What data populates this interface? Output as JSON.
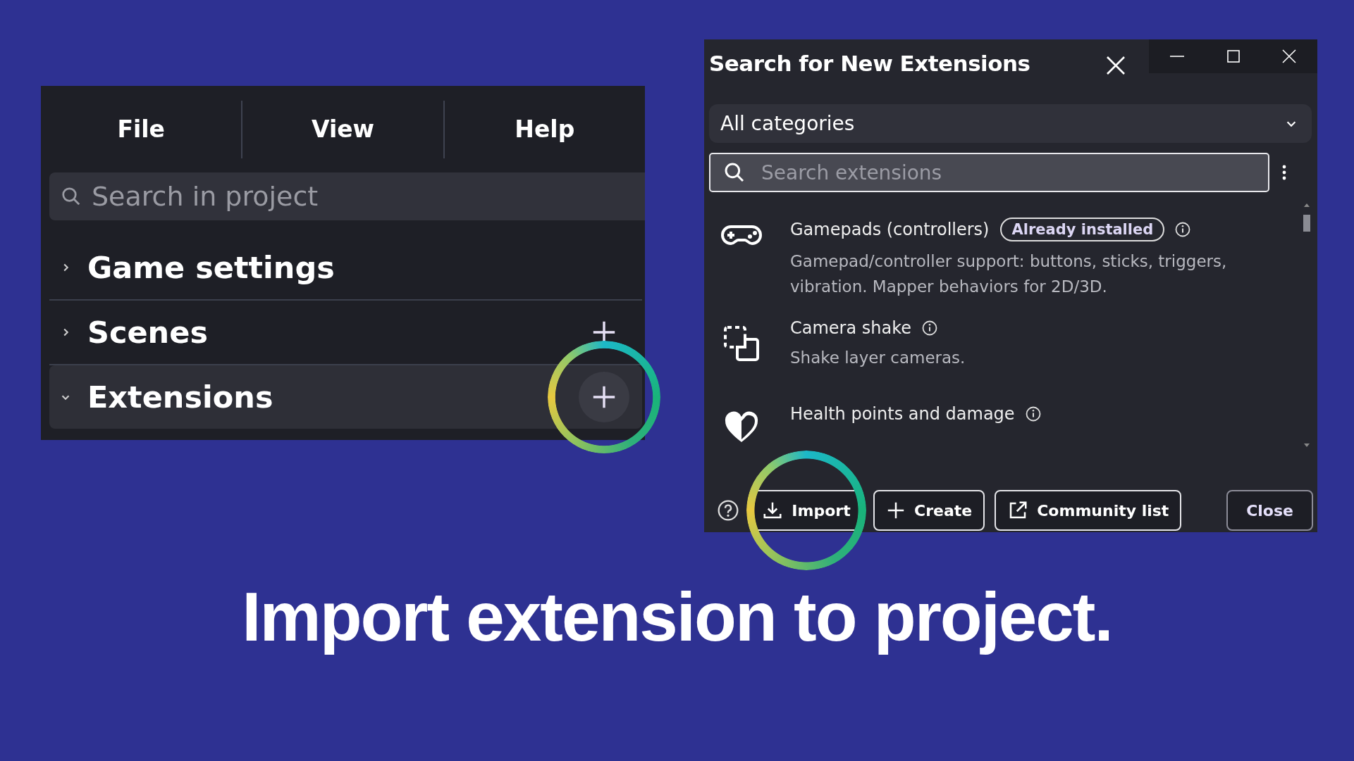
{
  "project_panel": {
    "menu": [
      {
        "label": "File"
      },
      {
        "label": "View"
      },
      {
        "label": "Help"
      }
    ],
    "search": {
      "placeholder": "Search in project"
    },
    "sections": [
      {
        "label": "Game settings",
        "expanded": false,
        "selected": false,
        "add_button": false
      },
      {
        "label": "Scenes",
        "expanded": false,
        "selected": false,
        "add_button": true,
        "highlighted": false
      },
      {
        "label": "Extensions",
        "expanded": true,
        "selected": true,
        "add_button": true,
        "highlighted": true
      }
    ]
  },
  "dialog": {
    "title": "Search for New Extensions",
    "category": "All categories",
    "search": {
      "placeholder": "Search extensions"
    },
    "extensions": [
      {
        "kind": "gamepad",
        "name": "Gamepads (controllers)",
        "badge": "Already installed",
        "description": "Gamepad/controller support: buttons, sticks, triggers, vibration. Mapper behaviors for 2D/3D."
      },
      {
        "kind": "camera",
        "name": "Camera shake",
        "description": "Shake layer cameras."
      },
      {
        "kind": "heart",
        "name": "Health points and damage"
      }
    ],
    "buttons": [
      {
        "kind": "import",
        "label": "Import",
        "highlighted": true
      },
      {
        "kind": "create",
        "label": "Create",
        "highlighted": false
      },
      {
        "kind": "community",
        "label": "Community list",
        "highlighted": false
      }
    ],
    "close": "Close"
  },
  "caption": "Import extension to project."
}
